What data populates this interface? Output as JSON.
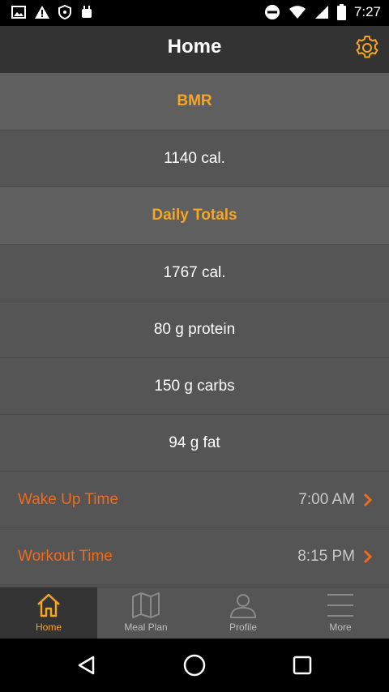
{
  "status_bar": {
    "time": "7:27",
    "icons": [
      "gallery-icon",
      "alert-icon",
      "shield-icon",
      "android-icon",
      "dnd-icon",
      "wifi-icon",
      "signal-icon",
      "battery-icon"
    ]
  },
  "header": {
    "title": "Home",
    "settings_icon": "gear-icon"
  },
  "sections": {
    "bmr": {
      "title": "BMR",
      "value": "1140 cal."
    },
    "daily_totals": {
      "title": "Daily Totals",
      "calories": "1767 cal.",
      "protein": "80 g protein",
      "carbs": "150 g carbs",
      "fat": "94 g fat"
    }
  },
  "schedule": {
    "wake_up": {
      "label": "Wake Up Time",
      "time": "7:00 AM"
    },
    "workout": {
      "label": "Workout Time",
      "time": "8:15 PM"
    }
  },
  "bottom_nav": [
    {
      "label": "Home",
      "icon": "home-icon",
      "active": true
    },
    {
      "label": "Meal Plan",
      "icon": "map-icon",
      "active": false
    },
    {
      "label": "Profile",
      "icon": "user-icon",
      "active": false
    },
    {
      "label": "More",
      "icon": "menu-icon",
      "active": false
    }
  ],
  "colors": {
    "accent": "#f5a623",
    "link": "#ee6a1c",
    "background": "#555555",
    "header": "#333333"
  }
}
